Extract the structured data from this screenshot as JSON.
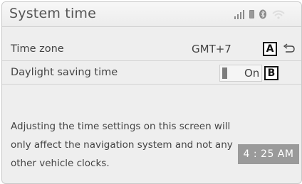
{
  "header": {
    "title": "System time",
    "icons": [
      "signal-icon",
      "battery-icon",
      "bluetooth-icon",
      "wifi-icon"
    ]
  },
  "settings": {
    "time_zone": {
      "label": "Time zone",
      "value": "GMT+7",
      "callout": "A"
    },
    "daylight_saving": {
      "label": "Daylight saving time",
      "state": "On",
      "callout": "B"
    }
  },
  "notice": "Adjusting the time settings on this screen will only affect the navigation system and not any other vehicle clocks.",
  "clock": "4 : 25 AM",
  "colors": {
    "background": "#eeeeee",
    "clock_bg": "#9a9a9a",
    "text": "#444444"
  }
}
